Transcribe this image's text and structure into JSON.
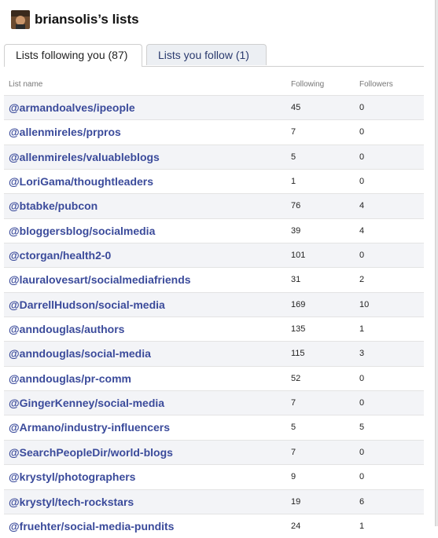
{
  "header": {
    "title": "briansolis’s lists"
  },
  "tabs": [
    {
      "label": "Lists following you (87)"
    },
    {
      "label": "Lists you follow (1)"
    }
  ],
  "table": {
    "columns": [
      "List name",
      "Following",
      "Followers"
    ],
    "rows": [
      {
        "name": "@armandoalves/ipeople",
        "following": "45",
        "followers": "0"
      },
      {
        "name": "@allenmireles/prpros",
        "following": "7",
        "followers": "0"
      },
      {
        "name": "@allenmireles/valuableblogs",
        "following": "5",
        "followers": "0"
      },
      {
        "name": "@LoriGama/thoughtleaders",
        "following": "1",
        "followers": "0"
      },
      {
        "name": "@btabke/pubcon",
        "following": "76",
        "followers": "4"
      },
      {
        "name": "@bloggersblog/socialmedia",
        "following": "39",
        "followers": "4"
      },
      {
        "name": "@ctorgan/health2-0",
        "following": "101",
        "followers": "0"
      },
      {
        "name": "@lauralovesart/socialmediafriends",
        "following": "31",
        "followers": "2"
      },
      {
        "name": "@DarrellHudson/social-media",
        "following": "169",
        "followers": "10"
      },
      {
        "name": "@anndouglas/authors",
        "following": "135",
        "followers": "1"
      },
      {
        "name": "@anndouglas/social-media",
        "following": "115",
        "followers": "3"
      },
      {
        "name": "@anndouglas/pr-comm",
        "following": "52",
        "followers": "0"
      },
      {
        "name": "@GingerKenney/social-media",
        "following": "7",
        "followers": "0"
      },
      {
        "name": "@Armano/industry-influencers",
        "following": "5",
        "followers": "5"
      },
      {
        "name": "@SearchPeopleDir/world-blogs",
        "following": "7",
        "followers": "0"
      },
      {
        "name": "@krystyl/photographers",
        "following": "9",
        "followers": "0"
      },
      {
        "name": "@krystyl/tech-rockstars",
        "following": "19",
        "followers": "6"
      },
      {
        "name": "@fruehter/social-media-pundits",
        "following": "24",
        "followers": "1"
      }
    ]
  }
}
